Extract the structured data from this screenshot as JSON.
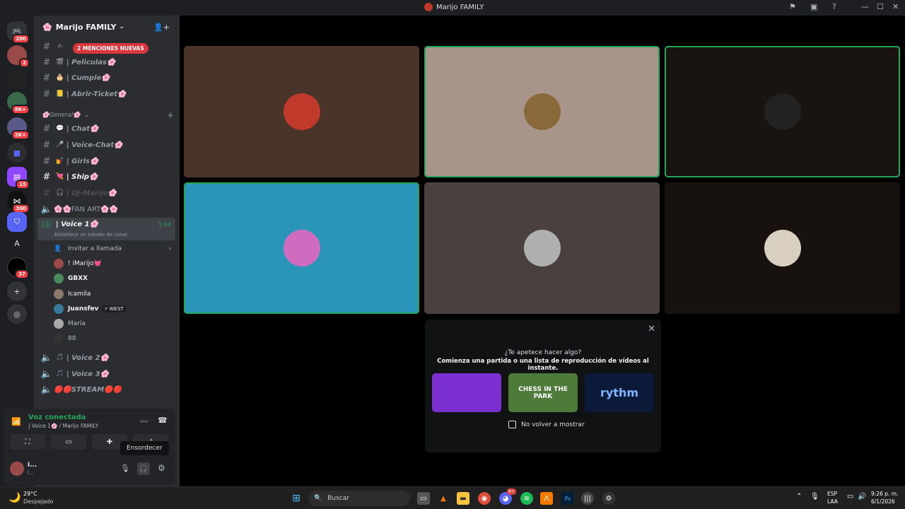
{
  "window": {
    "title": "Marijo FAMILY"
  },
  "servers": {
    "home_badge": "200",
    "items": [
      {
        "badge": "2"
      },
      {
        "badge": ""
      },
      {
        "badge": "8K+"
      },
      {
        "badge": "2K+"
      },
      {
        "badge": ""
      },
      {
        "badge": "15"
      },
      {
        "badge": "300"
      },
      {
        "badge": ""
      },
      {
        "label": "A",
        "badge": ""
      },
      {
        "badge": "37"
      }
    ]
  },
  "guild": {
    "name": "Marijo FAMILY"
  },
  "mention_pill": "2 MENCIONES NUEVAS",
  "channels": [
    {
      "name": "",
      "emoji": "✍"
    },
    {
      "name": "| Peliculas🌸",
      "emoji": "🎬"
    },
    {
      "name": "| Cumple🌸",
      "emoji": "🎂"
    },
    {
      "name": "| Abrir-Ticket🌸",
      "emoji": "📒"
    }
  ],
  "category": {
    "name": "🌸General🌸"
  },
  "general_channels": [
    {
      "name": "| Chat🌸",
      "emoji": "💬",
      "type": "text"
    },
    {
      "name": "| Voice-Chat🌸",
      "emoji": "🎤",
      "type": "text"
    },
    {
      "name": "| Girls🌸",
      "emoji": "💅",
      "type": "text"
    },
    {
      "name": "| Ship🌸",
      "emoji": "💘",
      "type": "text"
    },
    {
      "name": "| DJ-Marijo🌸",
      "emoji": "🎧",
      "type": "text"
    },
    {
      "name": "🌸🌸FAN ART🌸🌸",
      "emoji": "",
      "type": "voice"
    }
  ],
  "active_voice": {
    "name": "| Voice 1🌸",
    "timer": "1:44",
    "status_hint": "Establece un estado de canal",
    "invite": "Invitar a llamada",
    "users": [
      {
        "name": "! iMarijo💓",
        "tag": ""
      },
      {
        "name": "GBXX",
        "tag": ""
      },
      {
        "name": "Icamila",
        "tag": ""
      },
      {
        "name": "Juansfev",
        "tag": "⚡ WEST"
      },
      {
        "name": "María",
        "tag": ""
      },
      {
        "name": "88",
        "tag": ""
      }
    ]
  },
  "other_voice": [
    {
      "name": "| Voice 2🌸"
    },
    {
      "name": "| Voice 3🌸"
    },
    {
      "name": "🔴🔴STREAM🔴🔴"
    }
  ],
  "voice_panel": {
    "status": "Voz conectada",
    "location": "| Voice 1🌸 / Marijo FAMILY"
  },
  "user_panel": {
    "name": "i...",
    "sub": "i..."
  },
  "tooltip": "Ensordecer",
  "tiles": [
    {
      "bg": "#4a3328",
      "avatar": "#c0392b",
      "speaking": false
    },
    {
      "bg": "#a8958a",
      "avatar": "#8a6a3a",
      "speaking": true
    },
    {
      "bg": "#1a1411",
      "avatar": "#222222",
      "speaking": true
    },
    {
      "bg": "#2a95b8",
      "avatar": "#d06cc0",
      "speaking": true
    },
    {
      "bg": "#4a4040",
      "avatar": "#b0b0b0",
      "speaking": false
    },
    {
      "bg": "#17120e",
      "avatar": "#d8cfc0",
      "speaking": false
    }
  ],
  "activity": {
    "title": "¿Te apetece hacer algo?",
    "subtitle": "Comienza una partida o una lista de reproducción de vídeos al instante.",
    "cards": [
      {
        "label": "",
        "color": "#7b2fd0"
      },
      {
        "label": "CHESS IN THE PARK",
        "color": "#4e7a3a"
      },
      {
        "label": "rythm",
        "color": "#0c1a3a"
      }
    ],
    "checkbox_label": "No volver a mostrar"
  },
  "taskbar": {
    "weather_temp": "29°C",
    "weather_desc": "Despejado",
    "search": "Buscar",
    "lang1": "ESP",
    "lang2": "LAA",
    "time": "9:26 p. m.",
    "date": "6/1/2026",
    "discord_badge": "9+"
  }
}
